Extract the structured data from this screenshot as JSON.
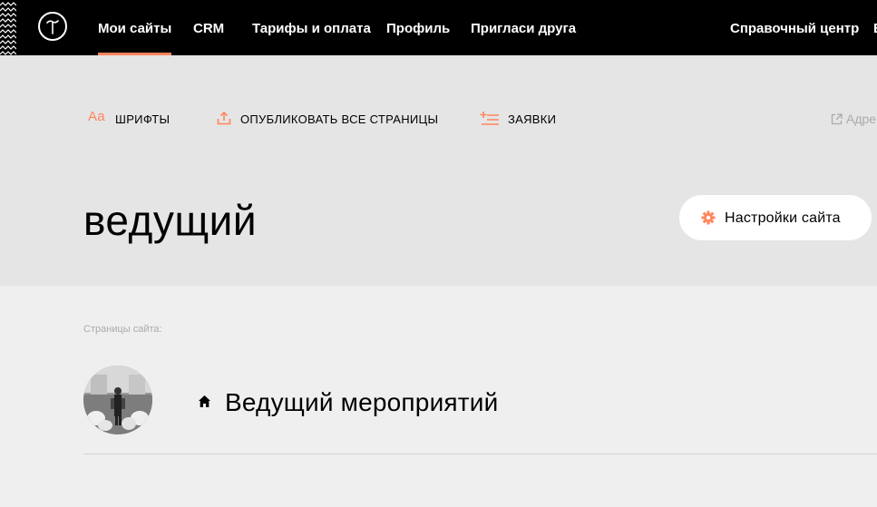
{
  "nav": {
    "items": [
      {
        "label": "Мои сайты",
        "active": true
      },
      {
        "label": "CRM",
        "active": false
      },
      {
        "label": "Тарифы и оплата",
        "active": false
      },
      {
        "label": "Профиль",
        "active": false
      },
      {
        "label": "Пригласи друга",
        "active": false
      }
    ],
    "help_label": "Справочный центр",
    "cut_label": "Е"
  },
  "toolbar": {
    "fonts_icon_text": "Aa",
    "fonts_label": "ШРИФТЫ",
    "publish_label": "ОПУБЛИКОВАТЬ ВСЕ СТРАНИЦЫ",
    "requests_label": "ЗАЯВКИ",
    "address_label": "Адре"
  },
  "site": {
    "title": "ведущий",
    "settings_label": "Настройки сайта"
  },
  "pages": {
    "section_label": "Страницы сайта:",
    "items": [
      {
        "title": "Ведущий мероприятий"
      }
    ]
  },
  "colors": {
    "accent": "#ff855d",
    "topbar": "#000000",
    "header_bg": "#e5e5e5",
    "page_bg": "#efefef"
  }
}
